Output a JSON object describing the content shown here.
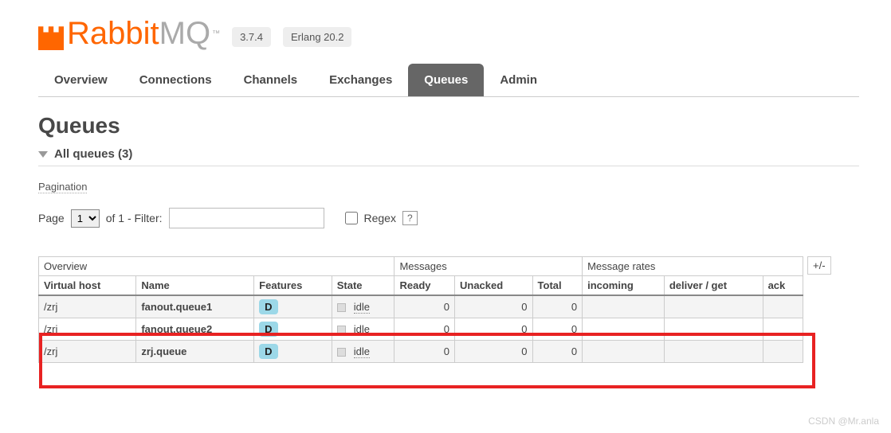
{
  "brand": {
    "part1": "Rabbit",
    "part2": "MQ",
    "tm": "™"
  },
  "versions": {
    "rabbit": "3.7.4",
    "erlang": "Erlang 20.2"
  },
  "tabs": [
    {
      "label": "Overview"
    },
    {
      "label": "Connections"
    },
    {
      "label": "Channels"
    },
    {
      "label": "Exchanges"
    },
    {
      "label": "Queues",
      "active": true
    },
    {
      "label": "Admin"
    }
  ],
  "page_title": "Queues",
  "section_title": "All queues (3)",
  "pagination_label": "Pagination",
  "filter": {
    "page_label": "Page",
    "page_value": "1",
    "of_label": "of 1  - Filter:",
    "regex_label": "Regex",
    "question": "?"
  },
  "table": {
    "groups": {
      "overview": "Overview",
      "messages": "Messages",
      "rates": "Message rates",
      "toggle": "+/-"
    },
    "cols": {
      "vhost": "Virtual host",
      "name": "Name",
      "features": "Features",
      "state": "State",
      "ready": "Ready",
      "unacked": "Unacked",
      "total": "Total",
      "incoming": "incoming",
      "deliver": "deliver / get",
      "ack": "ack"
    },
    "rows": [
      {
        "vhost": "/zrj",
        "name": "fanout.queue1",
        "feature": "D",
        "state": "idle",
        "ready": "0",
        "unacked": "0",
        "total": "0"
      },
      {
        "vhost": "/zrj",
        "name": "fanout.queue2",
        "feature": "D",
        "state": "idle",
        "ready": "0",
        "unacked": "0",
        "total": "0"
      },
      {
        "vhost": "/zrj",
        "name": "zrj.queue",
        "feature": "D",
        "state": "idle",
        "ready": "0",
        "unacked": "0",
        "total": "0"
      }
    ]
  },
  "watermark": "CSDN @Mr.anla"
}
